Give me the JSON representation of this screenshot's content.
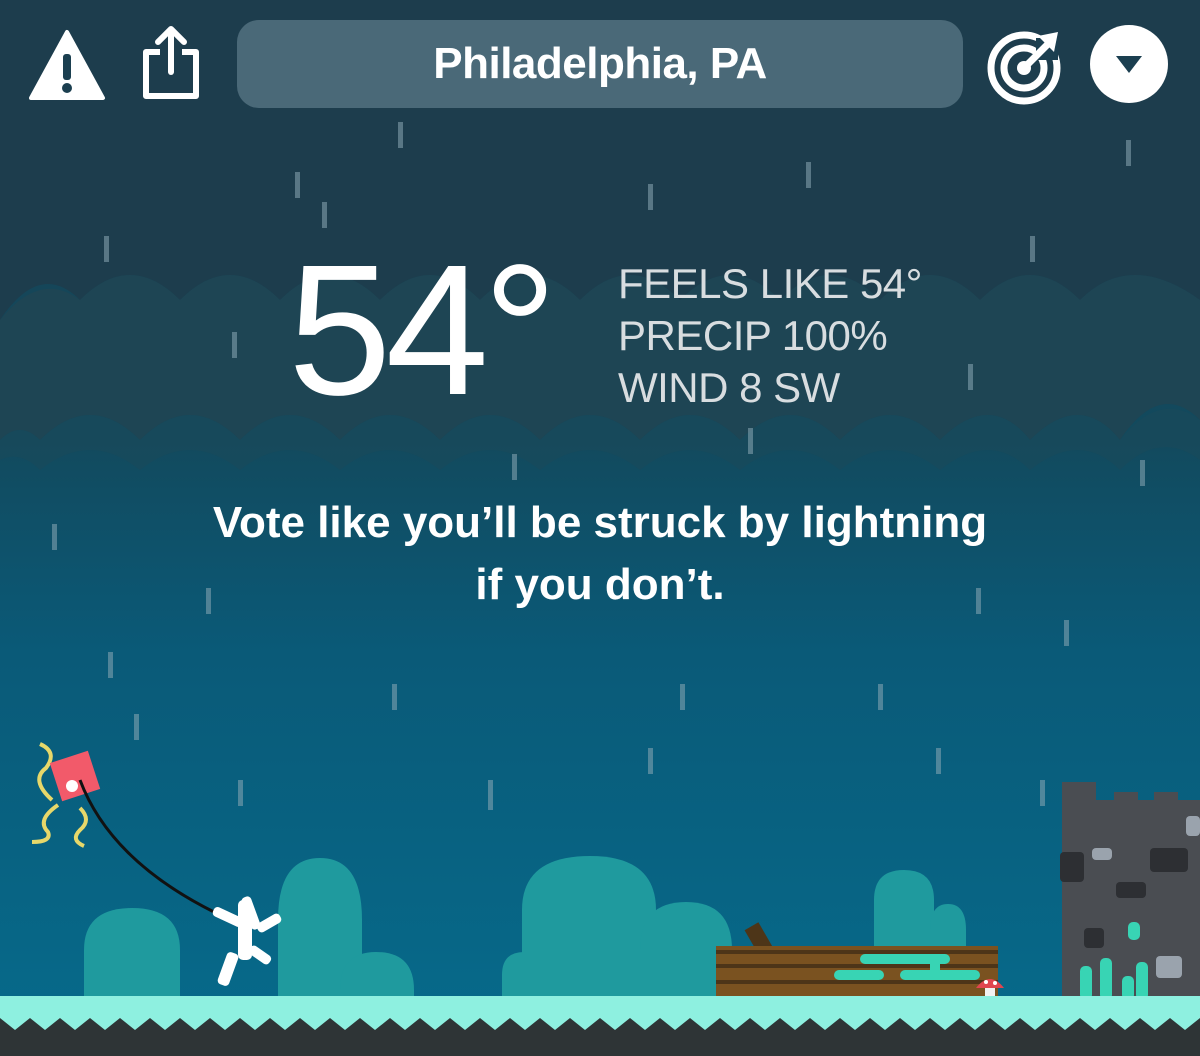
{
  "header": {
    "location": "Philadelphia, PA",
    "alert_icon": "warning-triangle-icon",
    "share_icon": "share-icon",
    "radar_icon": "radar-target-icon",
    "menu_icon": "chevron-down-icon"
  },
  "weather": {
    "temperature": "54°",
    "feels_like": "FEELS LIKE 54°",
    "precip": "PRECIP 100%",
    "wind": "WIND 8 SW"
  },
  "message": {
    "line1": "Vote like you’ll be struck by lightning",
    "line2": "if you don’t."
  },
  "colors": {
    "sky_top": "#1b3f50",
    "sky_bottom": "#066b8c",
    "cloud": "#1d3d4d",
    "ground_grass": "#8ef0e0",
    "ground_dark": "#2e3436",
    "bush": "#1f9a9e",
    "kite": "#f25a6a",
    "log": "#7a5220",
    "tower": "#4a4d52"
  }
}
